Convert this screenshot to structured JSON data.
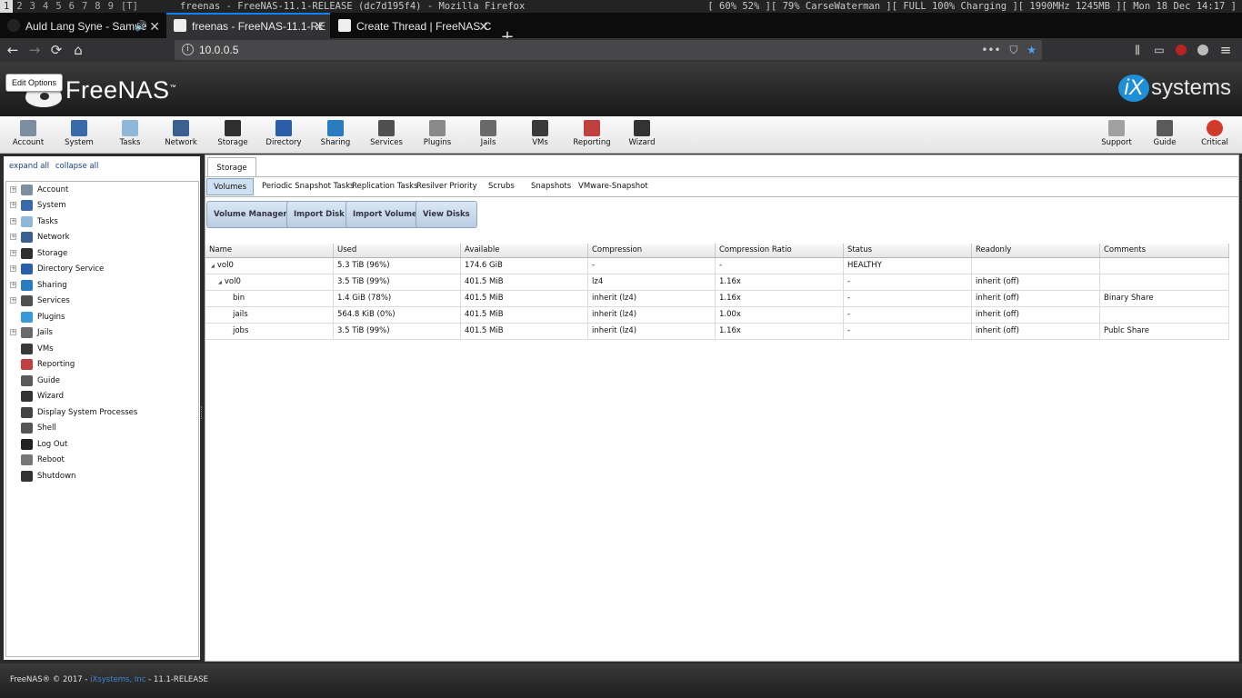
{
  "wm": {
    "workspaces": [
      "1",
      "2",
      "3",
      "4",
      "5",
      "6",
      "7",
      "8",
      "9",
      "[T]"
    ],
    "window_title": "freenas - FreeNAS-11.1-RELEASE (dc7d195f4) - Mozilla Firefox",
    "status": "[ 60% 52% ][ 79% CarseWaterman ][ FULL 100% Charging ][ 1990MHz 1245MB ][ Mon 18 Dec 14:17 ]"
  },
  "browser": {
    "tabs": [
      {
        "label": "Auld Lang Syne - Samue",
        "icon": "music-icon",
        "audio": "speaker-icon"
      },
      {
        "label": "freenas - FreeNAS-11.1-RE",
        "icon": "freenas-tab-icon"
      },
      {
        "label": "Create Thread | FreeNAS C",
        "icon": "freenas-tab-icon"
      }
    ],
    "url": "10.0.0.5"
  },
  "header": {
    "brand": "FreeNAS",
    "tm": "™",
    "edit_options": "Edit Options",
    "vendor_prefix": "iX",
    "vendor": "systems"
  },
  "toolbar": [
    {
      "label": "Account",
      "color": "#7d8ea1"
    },
    {
      "label": "System",
      "color": "#3a6aa8"
    },
    {
      "label": "Tasks",
      "color": "#8fb8d8"
    },
    {
      "label": "Network",
      "color": "#3b5f8f"
    },
    {
      "label": "Storage",
      "color": "#2f2f2f"
    },
    {
      "label": "Directory",
      "color": "#2b5ea8"
    },
    {
      "label": "Sharing",
      "color": "#2a7cc0"
    },
    {
      "label": "Services",
      "color": "#505050"
    },
    {
      "label": "Plugins",
      "color": "#8a8a8a"
    },
    {
      "label": "Jails",
      "color": "#6a6a6a"
    },
    {
      "label": "VMs",
      "color": "#3a3a3a"
    },
    {
      "label": "Reporting",
      "color": "#c04040"
    },
    {
      "label": "Wizard",
      "color": "#333333"
    }
  ],
  "toolbar_right": [
    {
      "label": "Support",
      "color": "#a0a0a0"
    },
    {
      "label": "Guide",
      "color": "#5a5a5a"
    },
    {
      "label": "Critical",
      "color": "#d23a2a"
    }
  ],
  "tree": {
    "expand_all": "expand all",
    "collapse_all": "collapse all",
    "items": [
      {
        "label": "Account",
        "expandable": true,
        "color": "#7d8ea1"
      },
      {
        "label": "System",
        "expandable": true,
        "color": "#3a6aa8"
      },
      {
        "label": "Tasks",
        "expandable": true,
        "color": "#8fb8d8"
      },
      {
        "label": "Network",
        "expandable": true,
        "color": "#3b5f8f"
      },
      {
        "label": "Storage",
        "expandable": true,
        "color": "#2f2f2f"
      },
      {
        "label": "Directory Service",
        "expandable": true,
        "color": "#2b5ea8"
      },
      {
        "label": "Sharing",
        "expandable": true,
        "color": "#2a7cc0"
      },
      {
        "label": "Services",
        "expandable": true,
        "color": "#505050"
      },
      {
        "label": "Plugins",
        "expandable": false,
        "color": "#3a9ad8"
      },
      {
        "label": "Jails",
        "expandable": true,
        "color": "#6a6a6a"
      },
      {
        "label": "VMs",
        "expandable": false,
        "color": "#3a3a3a"
      },
      {
        "label": "Reporting",
        "expandable": false,
        "color": "#c04040"
      },
      {
        "label": "Guide",
        "expandable": false,
        "color": "#5a5a5a"
      },
      {
        "label": "Wizard",
        "expandable": false,
        "color": "#333333"
      },
      {
        "label": "Display System Processes",
        "expandable": false,
        "color": "#444444"
      },
      {
        "label": "Shell",
        "expandable": false,
        "color": "#555555"
      },
      {
        "label": "Log Out",
        "expandable": false,
        "color": "#222222"
      },
      {
        "label": "Reboot",
        "expandable": false,
        "color": "#777777"
      },
      {
        "label": "Shutdown",
        "expandable": false,
        "color": "#333333"
      }
    ]
  },
  "main": {
    "tab": "Storage",
    "subtabs": [
      "Volumes",
      "Periodic Snapshot Tasks",
      "Replication Tasks",
      "Resilver Priority",
      "Scrubs",
      "Snapshots",
      "VMware-Snapshot"
    ],
    "buttons": [
      "Volume Manager",
      "Import Disk",
      "Import Volume",
      "View Disks"
    ],
    "columns": [
      "Name",
      "Used",
      "Available",
      "Compression",
      "Compression Ratio",
      "Status",
      "Readonly",
      "Comments"
    ],
    "rows": [
      {
        "name": "vol0",
        "level": 0,
        "toggle": "◢",
        "used": "5.3 TiB (96%)",
        "available": "174.6 GiB",
        "compression": "-",
        "ratio": "-",
        "status": "HEALTHY",
        "readonly": "",
        "comments": ""
      },
      {
        "name": "vol0",
        "level": 1,
        "toggle": "◢",
        "used": "3.5 TiB (99%)",
        "available": "401.5 MiB",
        "compression": "lz4",
        "ratio": "1.16x",
        "status": "-",
        "readonly": "inherit (off)",
        "comments": ""
      },
      {
        "name": "bin",
        "level": 2,
        "toggle": "",
        "used": "1.4 GiB (78%)",
        "available": "401.5 MiB",
        "compression": "inherit (lz4)",
        "ratio": "1.16x",
        "status": "-",
        "readonly": "inherit (off)",
        "comments": "Binary Share"
      },
      {
        "name": "jails",
        "level": 2,
        "toggle": "",
        "used": "564.8 KiB (0%)",
        "available": "401.5 MiB",
        "compression": "inherit (lz4)",
        "ratio": "1.00x",
        "status": "-",
        "readonly": "inherit (off)",
        "comments": ""
      },
      {
        "name": "jobs",
        "level": 2,
        "toggle": "",
        "used": "3.5 TiB (99%)",
        "available": "401.5 MiB",
        "compression": "inherit (lz4)",
        "ratio": "1.16x",
        "status": "-",
        "readonly": "inherit (off)",
        "comments": "Publc Share"
      }
    ]
  },
  "footer": {
    "text_a": "FreeNAS® © 2017 - ",
    "link": "iXsystems, Inc",
    "text_b": " - 11.1-RELEASE"
  }
}
